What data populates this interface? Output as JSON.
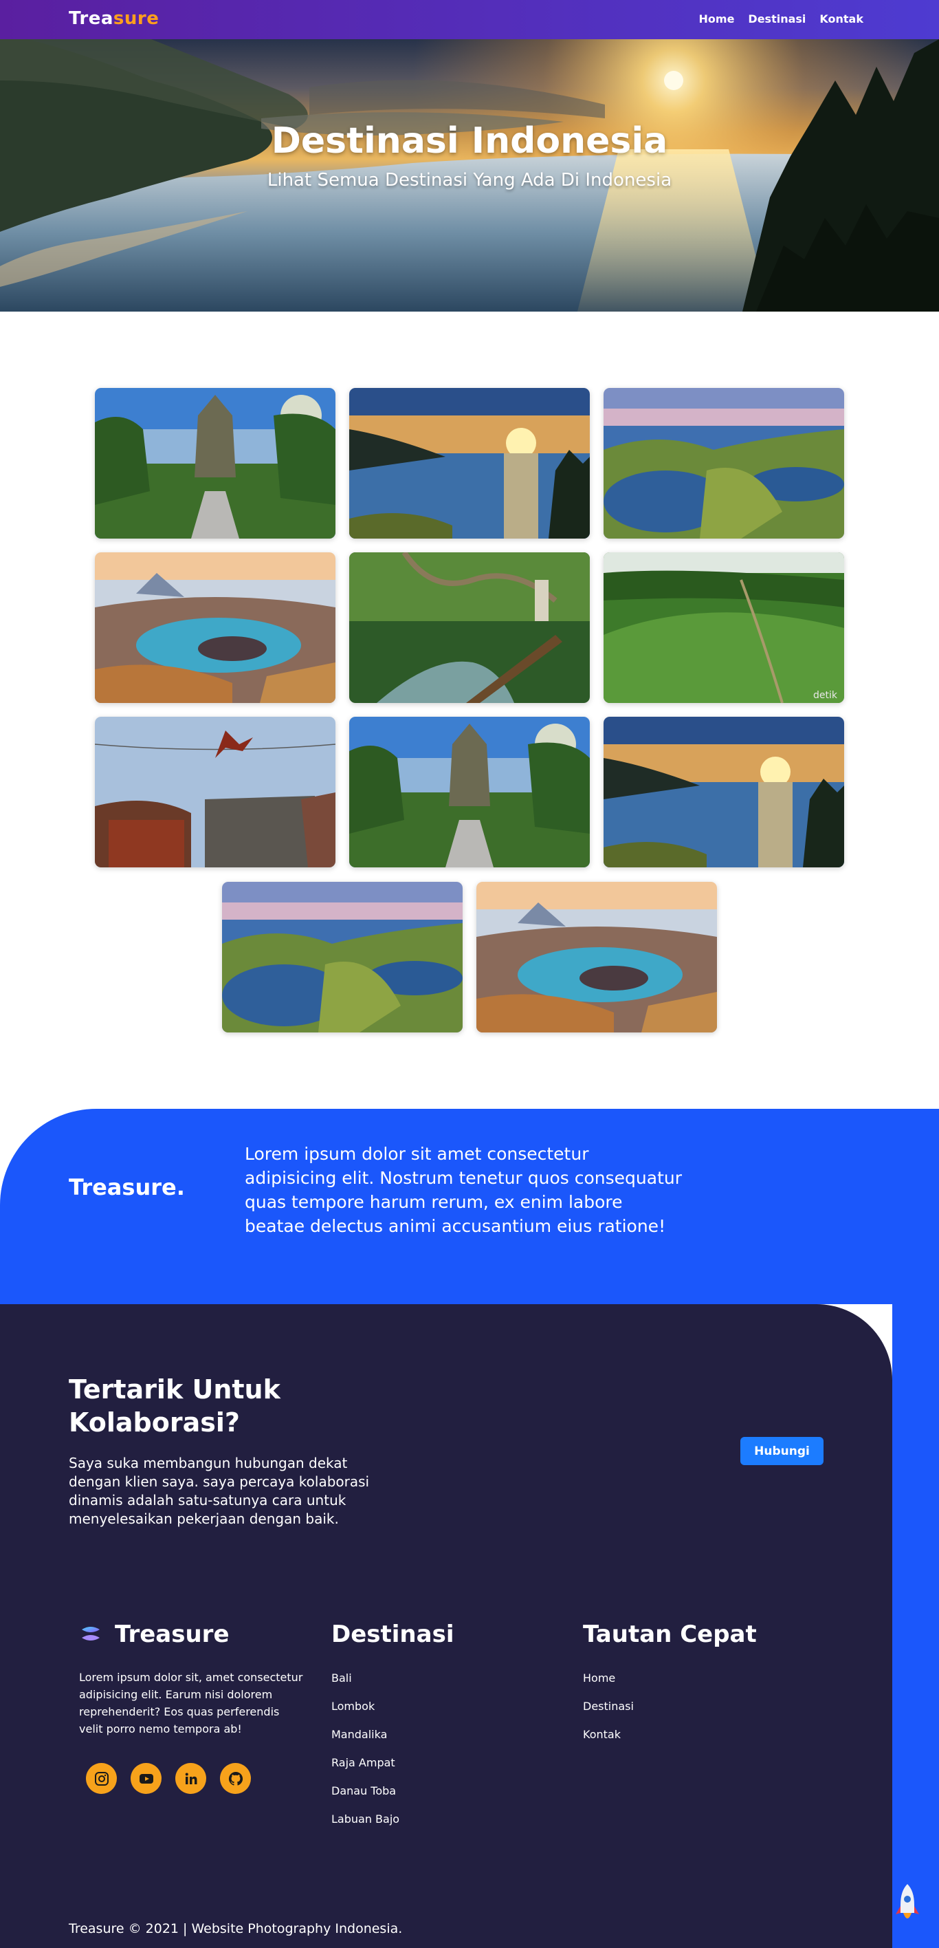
{
  "navbar": {
    "brand_main": "Trea",
    "brand_accent": "sure",
    "links": [
      "Home",
      "Destinasi",
      "Kontak"
    ]
  },
  "hero": {
    "title": "Destinasi Indonesia",
    "subtitle": "Lihat Semua Destinasi Yang Ada Di Indonesia"
  },
  "gallery": {
    "images": [
      "temple",
      "lake-sunset",
      "bay-hills",
      "crater-lake",
      "jungle-river",
      "green-hills",
      "stone-jump",
      "temple",
      "lake-sunset",
      "bay-hills",
      "crater-lake"
    ],
    "watermark": "detik"
  },
  "about": {
    "brand": "Treasure.",
    "text": "Lorem ipsum dolor sit amet consectetur adipisicing elit. Nostrum tenetur quos consequatur quas tempore harum rerum, ex enim labore beatae delectus animi accusantium eius ratione!"
  },
  "cta": {
    "title": "Tertarik Untuk Kolaborasi?",
    "text": "Saya suka membangun hubungan dekat dengan klien saya. saya percaya kolaborasi dinamis adalah satu-satunya cara untuk menyelesaikan pekerjaan dengan baik.",
    "button": "Hubungi"
  },
  "footer": {
    "brand": "Treasure",
    "description": "Lorem ipsum dolor sit, amet consectetur adipisicing elit. Earum nisi dolorem reprehenderit? Eos quas perferendis velit porro nemo tempora ab!",
    "socials": [
      "instagram-icon",
      "youtube-icon",
      "linkedin-icon",
      "github-icon"
    ],
    "destinasi_title": "Destinasi",
    "destinasi": [
      "Bali",
      "Lombok",
      "Mandalika",
      "Raja Ampat",
      "Danau Toba",
      "Labuan Bajo"
    ],
    "links_title": "Tautan Cepat",
    "links": [
      "Home",
      "Destinasi",
      "Kontak"
    ],
    "copyright": "Treasure © 2021 | Website Photography Indonesia."
  },
  "colors": {
    "accent": "#ff9f1c",
    "blue": "#1b57fb",
    "dark": "#221f40",
    "button": "#1c7cff",
    "social": "#f7a21b"
  }
}
